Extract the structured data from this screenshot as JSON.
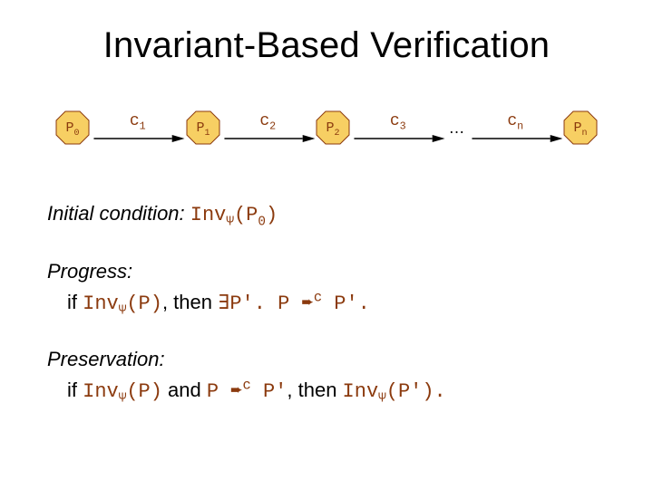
{
  "title": "Invariant-Based Verification",
  "nodes": {
    "p0": "P",
    "p0_sub": "0",
    "p1": "P",
    "p1_sub": "1",
    "p2": "P",
    "p2_sub": "2",
    "pn": "P",
    "pn_sub": "n"
  },
  "arrows": {
    "c1": "c",
    "c1_sub": "1",
    "c2": "c",
    "c2_sub": "2",
    "c3": "c",
    "c3_sub": "3",
    "cn": "c",
    "cn_sub": "n"
  },
  "ellipsis": "…",
  "colors": {
    "node_fill": "#f7cf63",
    "node_stroke": "#8b3a0e",
    "mono_text": "#8b3a0e"
  },
  "initial": {
    "label": "Initial condition:",
    "expr_pre": " Inv",
    "expr_sub": "Ψ",
    "expr_post": "(P",
    "expr_post_sub": "0",
    "expr_end": ")"
  },
  "progress": {
    "label": "Progress:",
    "line_if": "if ",
    "inv": "Inv",
    "inv_sub": "Ψ",
    "inv_arg": "(P)",
    "then": ", then ",
    "exists": "∃P'. P ",
    "arrow": "➨",
    "arrow_sup": "c",
    "tail": " P'."
  },
  "preservation": {
    "label": "Preservation:",
    "line_if": "if ",
    "inv": "Inv",
    "inv_sub": "Ψ",
    "inv_arg": "(P)",
    "and": " and ",
    "p_lhs": " P ",
    "arrow": "➨",
    "arrow_sup": "c",
    "p_rhs": " P'",
    "then": ", then ",
    "inv2": "Inv",
    "inv2_sub": "Ψ",
    "inv2_arg": "(P').",
    "tail": ""
  }
}
